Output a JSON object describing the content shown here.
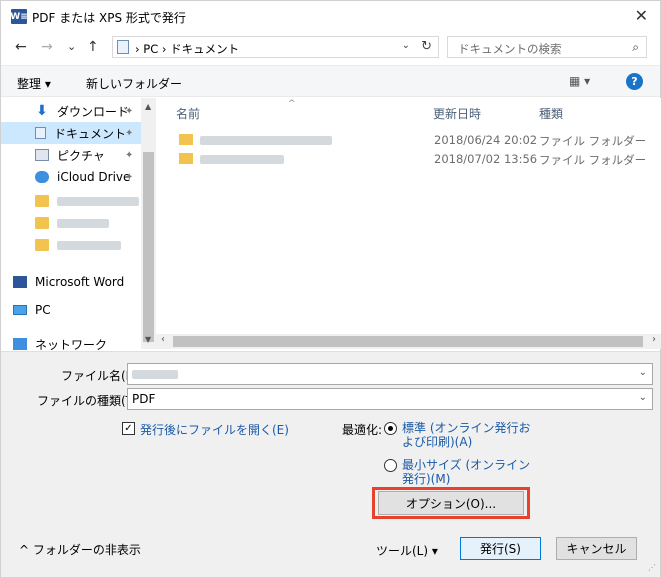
{
  "window": {
    "title": "PDF または XPS 形式で発行",
    "app_icon": "W≡",
    "close_glyph": "✕"
  },
  "address_bar": {
    "back_glyph": "←",
    "forward_glyph": "→",
    "recent_glyph": "⌄",
    "up_glyph": "↑",
    "path": "› PC › ドキュメント",
    "dropdown_glyph": "⌄",
    "refresh_glyph": "↻"
  },
  "search": {
    "placeholder": "ドキュメントの検索",
    "icon_glyph": "⌕"
  },
  "toolbar": {
    "organize_label": "整理 ▾",
    "new_folder_label": "新しいフォルダー",
    "view_glyph": "▦ ▾",
    "help_glyph": "?"
  },
  "nav": {
    "items": [
      {
        "label": "ダウンロード",
        "pinned": true
      },
      {
        "label": "ドキュメント",
        "pinned": true,
        "selected": true
      },
      {
        "label": "ピクチャ",
        "pinned": true
      },
      {
        "label": "iCloud Drive",
        "pinned": true
      },
      {
        "label": "Microsoft Word"
      },
      {
        "label": "PC"
      },
      {
        "label": "ネットワーク"
      }
    ],
    "pin_glyph": "📌"
  },
  "file_list": {
    "columns": {
      "name": "名前",
      "date": "更新日時",
      "type": "種類"
    },
    "sort_glyph": "^",
    "rows": [
      {
        "date": "2018/06/24 20:02",
        "type": "ファイル フォルダー"
      },
      {
        "date": "2018/07/02 13:56",
        "type": "ファイル フォルダー"
      }
    ]
  },
  "form": {
    "filename_label": "ファイル名(N):",
    "filetype_label": "ファイルの種類(T):",
    "filetype_value": "PDF",
    "open_after_label": "発行後にファイルを開く(E)",
    "optimize_label": "最適化:",
    "optimize_standard": "標準 (オンライン発行および印刷)(A)",
    "optimize_minimum": "最小サイズ (オンライン発行)(M)",
    "options_button": "オプション(O)...",
    "tools_label": "ツール(L)   ▾",
    "publish_button": "発行(S)",
    "cancel_button": "キャンセル",
    "hide_folders": "^  フォルダーの非表示"
  }
}
